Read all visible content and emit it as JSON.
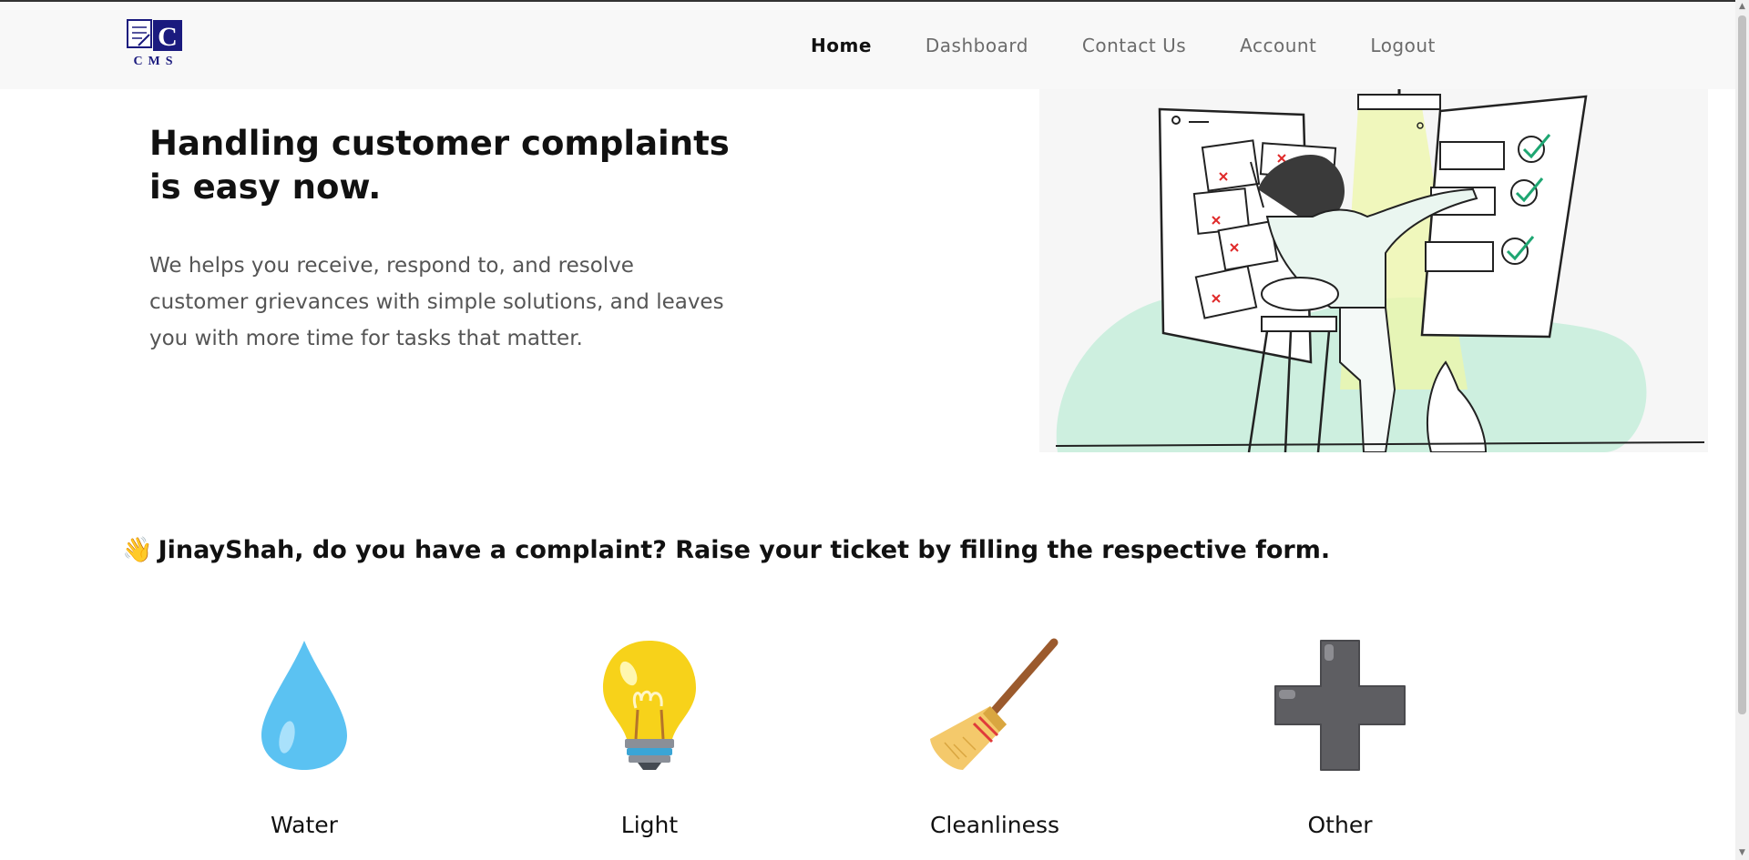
{
  "brand": {
    "logo_text": "CMS"
  },
  "nav": {
    "items": [
      {
        "label": "Home",
        "active": true
      },
      {
        "label": "Dashboard",
        "active": false
      },
      {
        "label": "Contact Us",
        "active": false
      },
      {
        "label": "Account",
        "active": false
      },
      {
        "label": "Logout",
        "active": false
      }
    ]
  },
  "hero": {
    "title_line1": "Handling customer complaints",
    "title_line2": "is easy now.",
    "text_line1": "We helps you receive, respond to, and resolve",
    "text_line2": "customer grievances with simple solutions, and leaves",
    "text_line3": "you with more time for tasks that matter.",
    "illustration": "person-checking-complaint-board-illustration"
  },
  "greeting": {
    "emoji": "👋",
    "text": "JinayShah, do you have a complaint? Raise your ticket by filling the respective form."
  },
  "categories": [
    {
      "label": "Water",
      "icon": "water-drop-icon"
    },
    {
      "label": "Light",
      "icon": "light-bulb-icon"
    },
    {
      "label": "Cleanliness",
      "icon": "broom-icon"
    },
    {
      "label": "Other",
      "icon": "plus-icon"
    }
  ],
  "colors": {
    "navbar_bg": "#f8f8f8",
    "logo_blue": "#1a1a7e",
    "water_blue": "#5bc2f2",
    "bulb_yellow": "#f7d21a",
    "plus_gray": "#5e5e62",
    "illustration_mint": "#c9eedd"
  }
}
